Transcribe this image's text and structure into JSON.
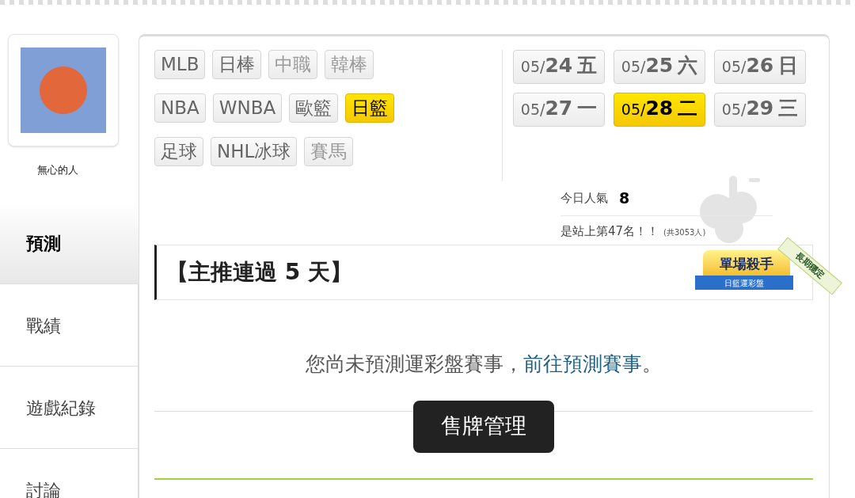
{
  "profile": {
    "name": "無心的人"
  },
  "nav": [
    {
      "label": "預測",
      "selected": true
    },
    {
      "label": "戰績",
      "selected": false
    },
    {
      "label": "遊戲紀錄",
      "selected": false
    },
    {
      "label": "討論",
      "selected": false
    }
  ],
  "sports": [
    [
      {
        "label": "MLB",
        "selected": false,
        "disabled": false
      },
      {
        "label": "日棒",
        "selected": false,
        "disabled": false
      },
      {
        "label": "中職",
        "selected": false,
        "disabled": true
      },
      {
        "label": "韓棒",
        "selected": false,
        "disabled": true
      }
    ],
    [
      {
        "label": "NBA",
        "selected": false,
        "disabled": false
      },
      {
        "label": "WNBA",
        "selected": false,
        "disabled": false
      },
      {
        "label": "歐籃",
        "selected": false,
        "disabled": false
      },
      {
        "label": "日籃",
        "selected": true,
        "disabled": false
      }
    ],
    [
      {
        "label": "足球",
        "selected": false,
        "disabled": false
      },
      {
        "label": "NHL冰球",
        "selected": false,
        "disabled": false
      },
      {
        "label": "賽馬",
        "selected": false,
        "disabled": true
      }
    ]
  ],
  "dates": [
    {
      "month": "05/",
      "day": "24",
      "weekday": "五",
      "selected": false
    },
    {
      "month": "05/",
      "day": "25",
      "weekday": "六",
      "selected": false
    },
    {
      "month": "05/",
      "day": "26",
      "weekday": "日",
      "selected": false
    },
    {
      "month": "05/",
      "day": "27",
      "weekday": "一",
      "selected": false
    },
    {
      "month": "05/",
      "day": "28",
      "weekday": "二",
      "selected": true
    },
    {
      "month": "05/",
      "day": "29",
      "weekday": "三",
      "selected": false
    }
  ],
  "stats": {
    "popularity_label": "今日人氣",
    "popularity_value": "8",
    "rank_text": "是站上第47名！！",
    "rank_total": "(共3053人)"
  },
  "streak_title": "【主推連過 5 天】",
  "badge": {
    "title": "單場殺手",
    "subtitle": "日籃運彩盤",
    "ribbon": "長期穩定"
  },
  "message": {
    "text": "您尚未預測運彩盤賽事，",
    "link": "前往預測賽事",
    "end": "。"
  },
  "toast": "售牌管理"
}
